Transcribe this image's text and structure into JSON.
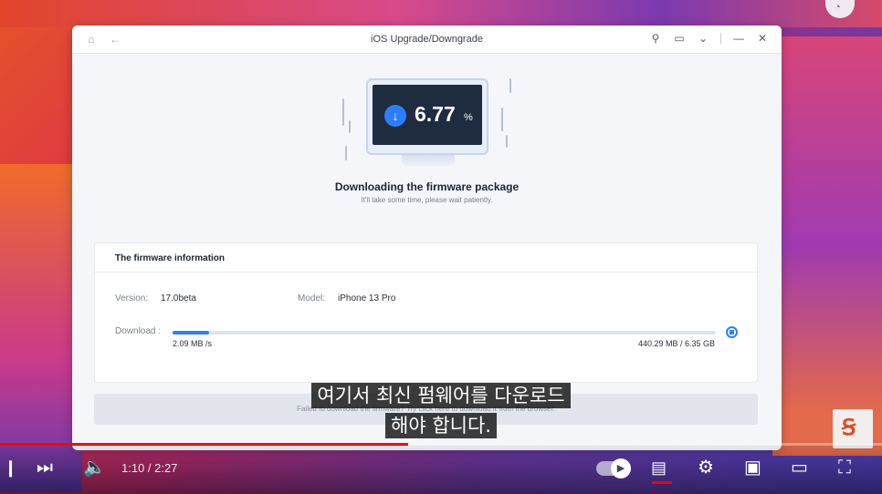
{
  "window": {
    "title": "iOS Upgrade/Downgrade",
    "home_icon": "home-icon",
    "back_icon": "back-arrow-icon",
    "user_icon": "user-icon",
    "message_icon": "message-icon",
    "menu_icon": "chevron-down-icon",
    "minimize_icon": "minimize-icon",
    "close_icon": "close-icon"
  },
  "download": {
    "percent_value": "6.77",
    "percent_sign": "%",
    "progress_fraction": 0.0677,
    "status_title": "Downloading the firmware package",
    "status_subtitle": "It'll take some time, please wait patiently."
  },
  "firmware_info": {
    "heading": "The firmware information",
    "version_label": "Version:",
    "version_value": "17.0beta",
    "model_label": "Model:",
    "model_value": "iPhone 13 Pro",
    "download_label": "Download :",
    "speed": "2.09 MB /s",
    "size": "440.29 MB / 6.35 GB"
  },
  "footer": {
    "note": "Failed to download the firmware? Try click here to download it from the browser."
  },
  "subtitles": {
    "line1": "여기서 최신 펌웨어를 다운로드",
    "line2": "해야 합니다."
  },
  "player": {
    "time": "1:10 / 2:27",
    "played_fraction": 0.463,
    "accent_color": "#ff0000"
  },
  "colors": {
    "accent": "#2b7fff",
    "screen": "#1f2b3e"
  }
}
